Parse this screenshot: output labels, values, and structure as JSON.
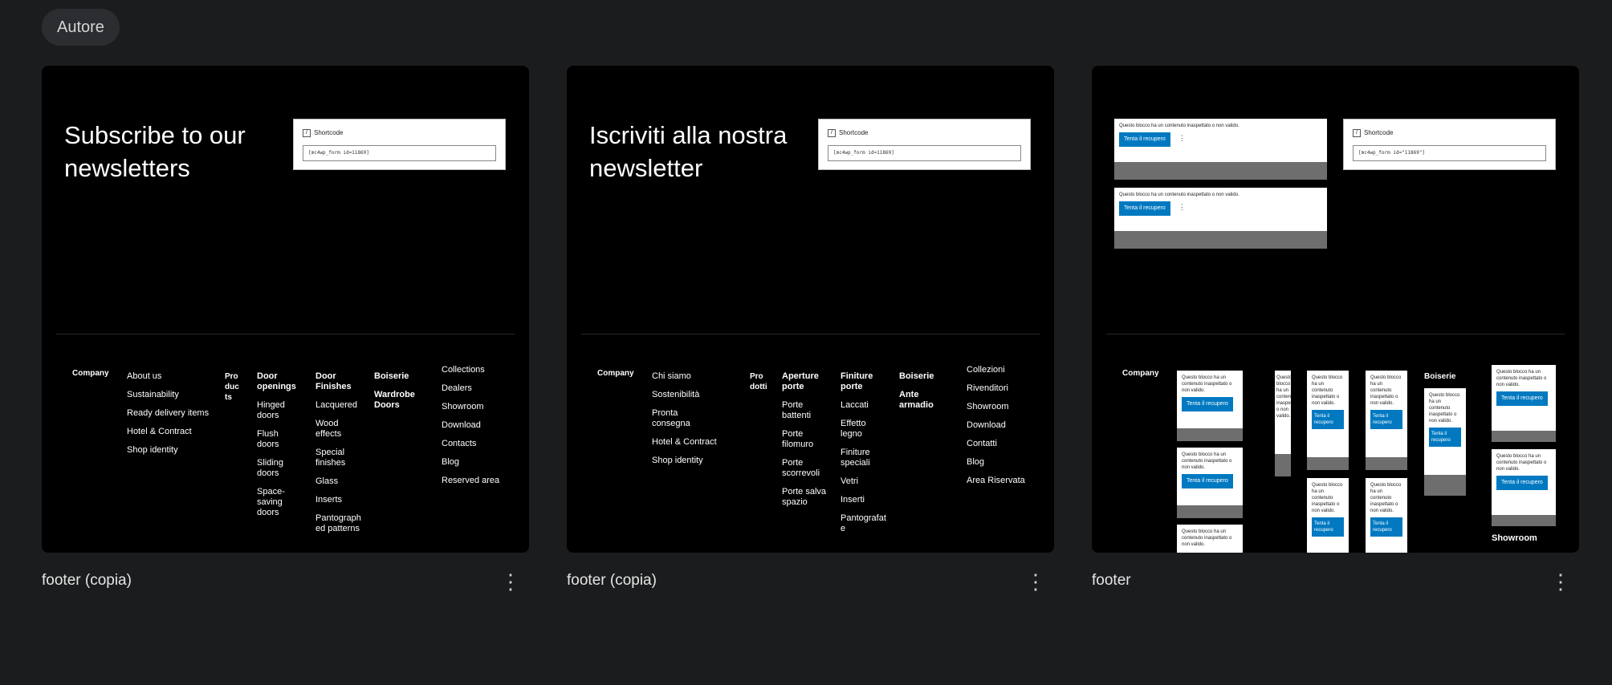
{
  "filter_chip": "Autore",
  "cards": [
    {
      "title": "footer (copia)",
      "headline": "Subscribe to our newsletters",
      "shortcode_label": "Shortcode",
      "shortcode_value": "[mc4wp_form id=11869]",
      "company": "Company",
      "col1": [
        "About us",
        "Sustainability",
        "Ready delivery items",
        "Hotel & Contract",
        "Shop identity"
      ],
      "col2_head": "Products",
      "col3_head": "Door openings",
      "col3": [
        "Hinged doors",
        "Flush doors",
        "Sliding doors",
        "Space-saving doors"
      ],
      "col4_head": "Door Finishes",
      "col4": [
        "Lacquered",
        "Wood effects",
        "Special finishes",
        "Glass",
        "Inserts",
        "Pantographed patterns"
      ],
      "col5_head": "Boiserie",
      "col5": [
        "Wardrobe Doors"
      ],
      "col6": [
        "Collections",
        "Dealers",
        "Showroom",
        "Download",
        "Contacts",
        "Blog",
        "Reserved area"
      ]
    },
    {
      "title": "footer (copia)",
      "headline": "Iscriviti alla nostra newsletter",
      "shortcode_label": "Shortcode",
      "shortcode_value": "[mc4wp_form id=11869]",
      "company": "Company",
      "col1": [
        "Chi siamo",
        "Sostenibilità",
        "Pronta consegna",
        "Hotel & Contract",
        "Shop identity"
      ],
      "col2_head": "Prodotti",
      "col3_head": "Aperture porte",
      "col3": [
        "Porte battenti",
        "Porte filomuro",
        "Porte scorrevoli",
        "Porte salvaspazio"
      ],
      "col4_head": "Finiture porte",
      "col4": [
        "Laccati",
        "Effetto legno",
        "Finiture speciali",
        "Vetri",
        "Inserti",
        "Pantografate"
      ],
      "col5_head": "Boiserie",
      "col5": [
        "Ante armadio"
      ],
      "col6": [
        "Collezioni",
        "Rivenditori",
        "Showroom",
        "Download",
        "Contatti",
        "Blog",
        "Area Riservata"
      ]
    },
    {
      "title": "footer",
      "shortcode_label": "Shortcode",
      "shortcode_value": "[mc4wp_form id=\"11869\"]",
      "error_text": "Questo blocco ha un contenuto inaspettato o non valido.",
      "retry_label": "Tenta il recupero",
      "company": "Company",
      "boiserie": "Boiserie",
      "showroom": "Showroom"
    }
  ],
  "menu_icon": "kebab-menu-icon"
}
